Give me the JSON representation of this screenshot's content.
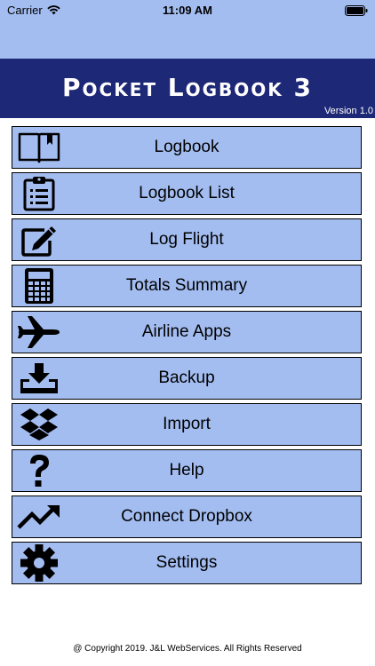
{
  "status": {
    "carrier": "Carrier",
    "time": "11:09 AM"
  },
  "header": {
    "title": "Pocket Logbook 3",
    "version": "Version 1.0"
  },
  "menu": [
    {
      "label": "Logbook",
      "icon": "book-icon"
    },
    {
      "label": "Logbook List",
      "icon": "clipboard-list-icon"
    },
    {
      "label": "Log Flight",
      "icon": "edit-icon"
    },
    {
      "label": "Totals Summary",
      "icon": "calculator-icon"
    },
    {
      "label": "Airline Apps",
      "icon": "airplane-icon"
    },
    {
      "label": "Backup",
      "icon": "download-tray-icon"
    },
    {
      "label": "Import",
      "icon": "dropbox-icon"
    },
    {
      "label": "Help",
      "icon": "question-icon"
    },
    {
      "label": "Connect Dropbox",
      "icon": "trend-up-icon"
    },
    {
      "label": "Settings",
      "icon": "gear-icon"
    }
  ],
  "footer": {
    "copyright": "@ Copyright 2019. J&L WebServices. All Rights Reserved"
  },
  "colors": {
    "status_bg": "#a3bdf1",
    "title_bg": "#1d2876",
    "button_bg": "#a3bdf1"
  }
}
